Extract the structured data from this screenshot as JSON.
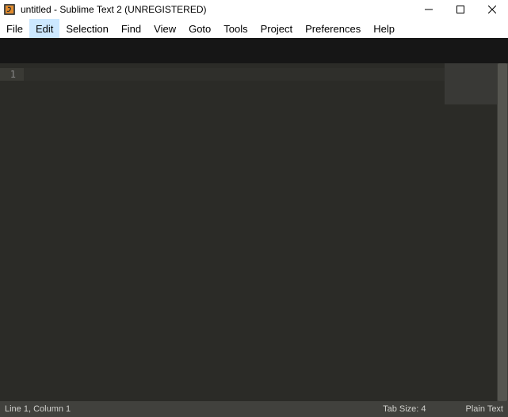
{
  "titlebar": {
    "title": "untitled - Sublime Text 2 (UNREGISTERED)"
  },
  "menu": {
    "items": [
      "File",
      "Edit",
      "Selection",
      "Find",
      "View",
      "Goto",
      "Tools",
      "Project",
      "Preferences",
      "Help"
    ],
    "active_index": 1
  },
  "editor": {
    "line_numbers": [
      "1"
    ]
  },
  "statusbar": {
    "position": "Line 1, Column 1",
    "tab_size": "Tab Size: 4",
    "language": "Plain Text"
  }
}
